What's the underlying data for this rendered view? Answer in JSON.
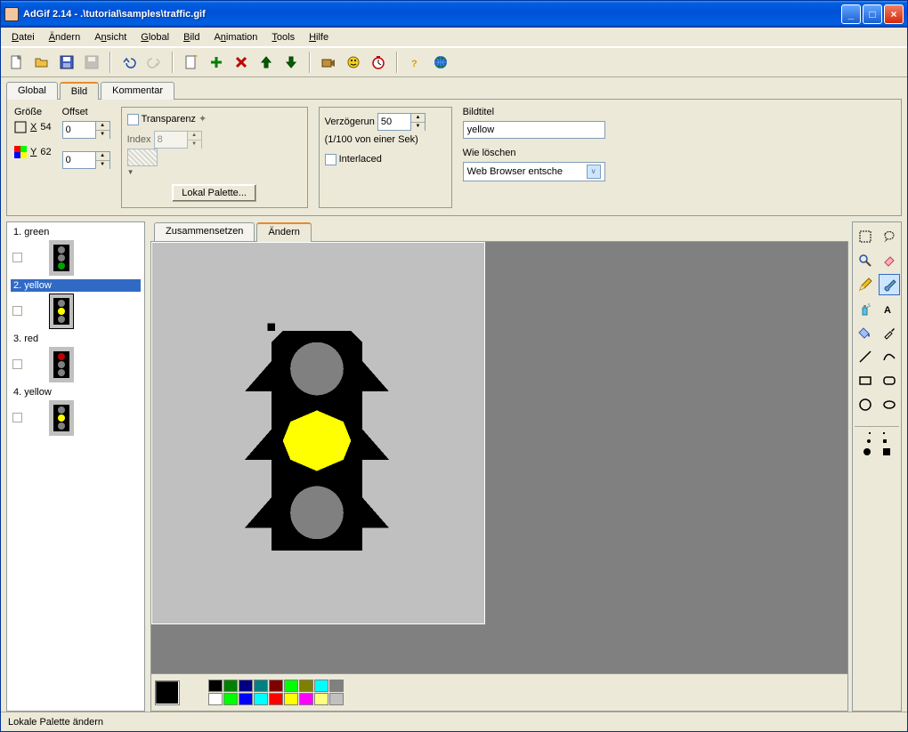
{
  "title": "AdGif 2.14 - .\\tutorial\\samples\\traffic.gif",
  "menu": [
    "Datei",
    "Ändern",
    "Ansicht",
    "Global",
    "Bild",
    "Animation",
    "Tools",
    "Hilfe"
  ],
  "tabs": {
    "global": "Global",
    "bild": "Bild",
    "kommentar": "Kommentar"
  },
  "props": {
    "size_label": "Größe",
    "offset_label": "Offset",
    "x_label": "X",
    "y_label": "Y",
    "x_val": "54",
    "y_val": "62",
    "off_x": "0",
    "off_y": "0",
    "transparenz": "Transparenz",
    "index_label": "Index",
    "index_val": "8",
    "lokal_palette": "Lokal Palette...",
    "delay_label": "Verzögerun",
    "delay_val": "50",
    "delay_hint": "(1/100 von einer Sek)",
    "interlaced": "Interlaced",
    "bildtitel_label": "Bildtitel",
    "bildtitel_val": "yellow",
    "wie_loeschen": "Wie löschen",
    "disposal": "Web Browser entsche"
  },
  "frames": [
    {
      "label": "1. green",
      "lights": [
        "#808080",
        "#808080",
        "#00a000"
      ]
    },
    {
      "label": "2. yellow",
      "lights": [
        "#808080",
        "#ffff00",
        "#808080"
      ],
      "selected": true
    },
    {
      "label": "3. red",
      "lights": [
        "#c00000",
        "#808080",
        "#808080"
      ]
    },
    {
      "label": "4. yellow",
      "lights": [
        "#808080",
        "#ffff00",
        "#808080"
      ]
    }
  ],
  "subtabs": {
    "zusammen": "Zusammensetzen",
    "aendern": "Ändern"
  },
  "palette": {
    "current": "#000000",
    "row1": [
      "#000000",
      "#008000",
      "#000080",
      "#008080",
      "#800000",
      "#00ff00",
      "#808000",
      "#00ffff",
      "#808080"
    ],
    "row2": [
      "#ffffff",
      "#00ff00",
      "#0000ff",
      "#00ffff",
      "#ff0000",
      "#ffff00",
      "#ff00ff",
      "#ffff80",
      "#c0c0c0"
    ]
  },
  "status": "Lokale Palette ändern"
}
